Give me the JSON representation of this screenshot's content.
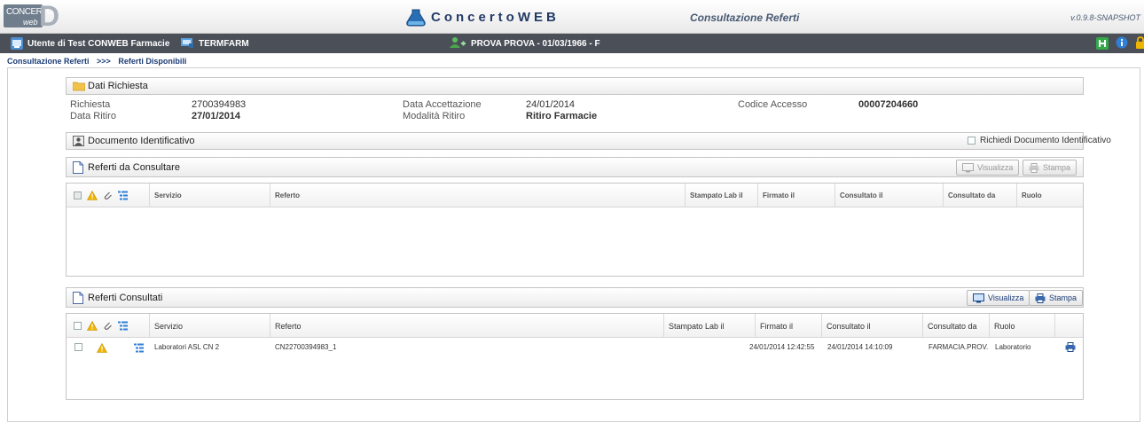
{
  "header": {
    "logo_top": "CONCERTO",
    "logo_bottom": "web",
    "logo_letter": "D",
    "brand": "ConcertoWEB",
    "module": "Consultazione Referti",
    "version": "v.0.9.8-SNAPSHOT"
  },
  "topbar": {
    "user": "Utente di Test CONWEB Farmacie",
    "terminal": "TERMFARM",
    "patient": "PROVA PROVA - 01/03/1966 - F"
  },
  "breadcrumb": [
    "Consultazione Referti",
    ">>>",
    "Referti Disponibili"
  ],
  "dati_richiesta": {
    "title": "Dati Richiesta",
    "richiesta_label": "Richiesta",
    "richiesta_value": "2700394983",
    "data_ritiro_label": "Data Ritiro",
    "data_ritiro_value": "27/01/2014",
    "data_accettazione_label": "Data Accettazione",
    "data_accettazione_value": "24/01/2014",
    "modalita_label": "Modalità Ritiro",
    "modalita_value": "Ritiro Farmacie",
    "codice_label": "Codice Accesso",
    "codice_value": "00007204660"
  },
  "documento": {
    "title": "Documento Identificativo",
    "richiedi_label": "Richiedi Documento Identificativo"
  },
  "da_consultare": {
    "title": "Referti da Consultare",
    "btn_visualizza": "Visualizza",
    "btn_stampa": "Stampa",
    "columns": [
      "Servizio",
      "Referto",
      "Stampato Lab il",
      "Firmato il",
      "Consultato il",
      "Consultato da",
      "Ruolo"
    ]
  },
  "consultati": {
    "title": "Referti Consultati",
    "btn_visualizza": "Visualizza",
    "btn_stampa": "Stampa",
    "columns": [
      "Servizio",
      "Referto",
      "Stampato Lab il",
      "Firmato il",
      "Consultato il",
      "Consultato da",
      "Ruolo"
    ],
    "rows": [
      {
        "servizio": "Laboratori ASL CN 2",
        "referto": "CN22700394983_1",
        "stampato": "",
        "firmato": "24/01/2014 12:42:55",
        "consultato_il": "24/01/2014 14:10:09",
        "consultato_da": "FARMACIA.PROV.",
        "ruolo": "Laboratorio"
      }
    ]
  },
  "colors": {
    "brand": "#233a66",
    "bar": "#4a4f58",
    "warning": "#f0b400",
    "link": "#1c3d77"
  }
}
